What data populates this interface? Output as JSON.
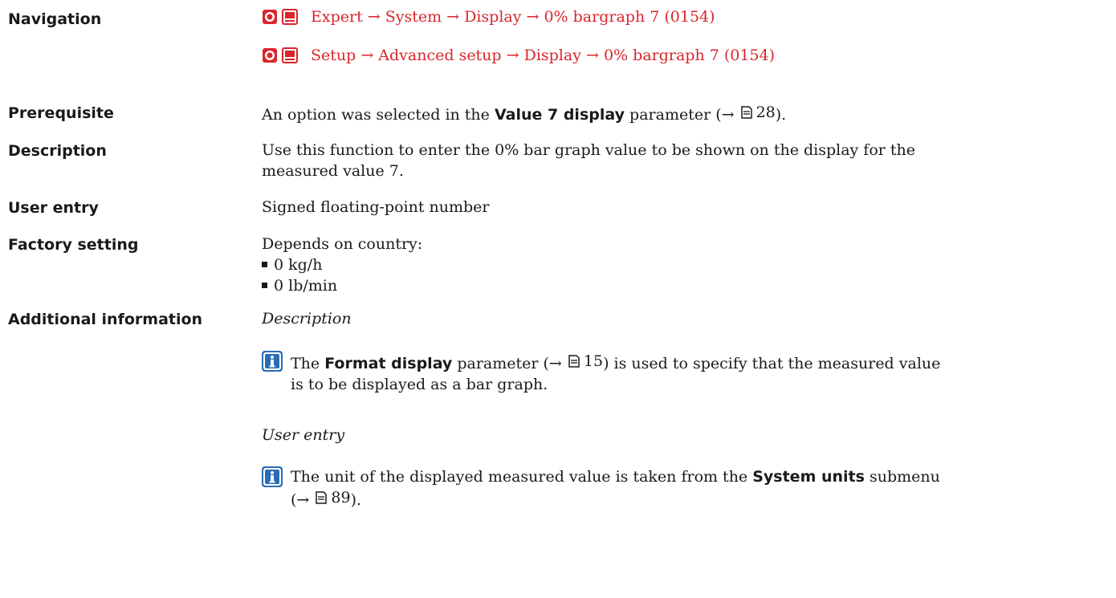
{
  "navigation": {
    "label": "Navigation",
    "paths": [
      "Expert → System → Display → 0% bargraph 7 (0154)",
      "Setup → Advanced setup → Display → 0% bargraph 7 (0154)"
    ],
    "icons": [
      "operating-menu-icon",
      "display-menu-icon"
    ],
    "color": "#d9262b"
  },
  "prerequisite": {
    "label": "Prerequisite",
    "pre": "An option was selected in the ",
    "param": "Value 7 display",
    "post": " parameter (→ ",
    "page": "28",
    "end": ")."
  },
  "description": {
    "label": "Description",
    "line1": "Use this function to enter the 0% bar graph value to be shown on the display for the",
    "line2": "measured value 7."
  },
  "user_entry": {
    "label": "User entry",
    "value": "Signed floating-point number"
  },
  "factory_setting": {
    "label": "Factory setting",
    "intro": "Depends on country:",
    "items": [
      "0 kg/h",
      "0 lb/min"
    ]
  },
  "additional_information": {
    "label": "Additional information",
    "sections": [
      {
        "heading": "Description",
        "pre": "The ",
        "param": "Format display",
        "mid": " parameter (→ ",
        "page": "15",
        "post": ") is used to specify that the measured value",
        "line2": "is to be displayed as a bar graph."
      },
      {
        "heading": "User entry",
        "pre": "The unit of the displayed measured value is taken from the ",
        "param": "System units",
        "post": " submenu",
        "line2_pre": "(→ ",
        "page": "89",
        "line2_post": ")."
      }
    ]
  }
}
